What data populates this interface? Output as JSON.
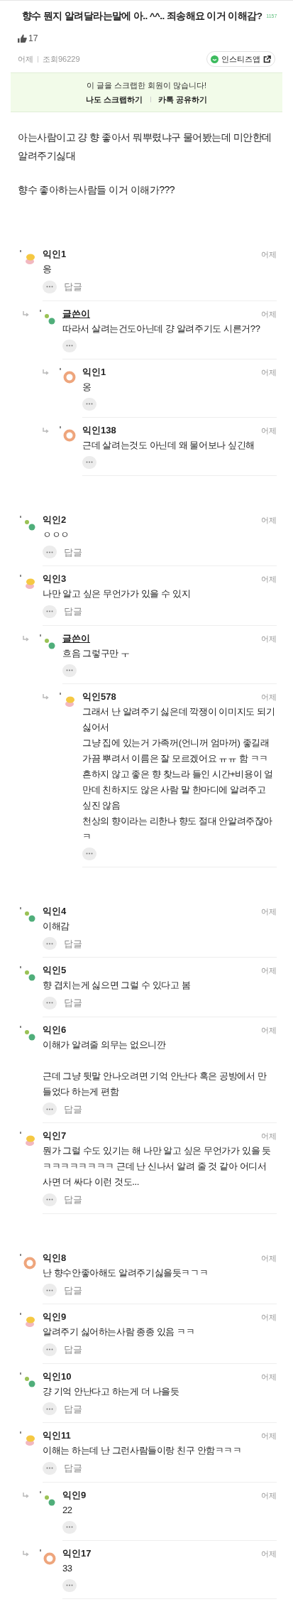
{
  "post": {
    "title": "향수 뭔지 알려달라는말에 아.. ^^.. 죄송해요 이거 이해감?",
    "count": "1157",
    "likes": "17",
    "date": "어제",
    "views": "조회96229",
    "app_button": "인스티즈앱"
  },
  "scrap_box": {
    "message": "이 글을 스크랩한 회원이 많습니다!",
    "actions": [
      "나도 스크랩하기",
      "카톡 공유하기"
    ]
  },
  "body": [
    "아는사람이고 걍 향 좋아서 뭐뿌렸냐구 물어봤는데 미안한데 알려주기싫대",
    "향수 좋아하는사람들 이거 이해가???"
  ],
  "comment_groups": [
    {
      "comments": [
        {
          "author": "익인1",
          "is_writer": false,
          "kind": "sun",
          "time": "어제",
          "text": "응",
          "reply_label": "답글",
          "children": [
            {
              "author": "글쓴이",
              "is_writer": true,
              "kind": "dots",
              "time": "어제",
              "text": "따라서 살려는건도아닌데 걍 알려주기도 시른거??",
              "children": [
                {
                  "author": "익인1",
                  "is_writer": false,
                  "kind": "ring",
                  "time": "어제",
                  "text": "옹"
                },
                {
                  "author": "익인138",
                  "is_writer": false,
                  "kind": "ring",
                  "time": "어제",
                  "text": "근데 살려는것도 아닌데 왜 물어보나 싶긴해"
                }
              ]
            }
          ]
        }
      ]
    },
    {
      "comments": [
        {
          "author": "익인2",
          "is_writer": false,
          "kind": "dots",
          "time": "어제",
          "text": "ㅇㅇㅇ",
          "reply_label": "답글"
        },
        {
          "author": "익인3",
          "is_writer": false,
          "kind": "sun",
          "time": "어제",
          "text": "나만 알고 싶은 무언가가 있을 수 있지",
          "reply_label": "답글",
          "children": [
            {
              "author": "글쓴이",
              "is_writer": true,
              "kind": "dots",
              "time": "어제",
              "text": "흐음 그렇구만 ㅜ",
              "children": [
                {
                  "author": "익인578",
                  "is_writer": false,
                  "kind": "sun",
                  "time": "어제",
                  "text": "그래서 난 알려주기 싫은데 깍쟁이 이미지도 되기 싫어서\n그냥 집에 있는거 가족꺼(언니꺼 엄마꺼) 좋길래 가끔 뿌려서 이름은 잘 모르겠어요 ㅠㅠ 함 ㅋㅋ\n흔하지 않고 좋은 향 찾느라 들인 시간+비용이 얼만데 친하지도 않은 사람 말 한마디에 알려주고 싶진 않음\n천상의 향이라는 리한나 향도 절대 안알려주잖아 ㅋ"
                }
              ]
            }
          ]
        }
      ]
    },
    {
      "comments": [
        {
          "author": "익인4",
          "is_writer": false,
          "kind": "dots",
          "time": "어제",
          "text": "이해감",
          "reply_label": "답글"
        },
        {
          "author": "익인5",
          "is_writer": false,
          "kind": "dots",
          "time": "어제",
          "text": "향 겹치는게 싫으면 그럴 수 있다고 봄",
          "reply_label": "답글"
        },
        {
          "author": "익인6",
          "is_writer": false,
          "kind": "dots",
          "time": "어제",
          "text": "이해가 알려줄 의무는 없으니깐\n\n근데 그냥 뒷말 안나오려면 기억 안난다 혹은 공방에서 만들었다 하는게 편함",
          "reply_label": "답글"
        },
        {
          "author": "익인7",
          "is_writer": false,
          "kind": "sun",
          "time": "어제",
          "text": "뭔가 그럴 수도 있기는 해 나만 알고 싶은 무언가가 있을 듯 ㅋㅋㅋㅋㅋㅋㅋㅋ 근데 난 신나서 알려 줄 것 같아 어디서 사면 더 싸다 이런 것도...",
          "reply_label": "답글"
        }
      ]
    },
    {
      "comments": [
        {
          "author": "익인8",
          "is_writer": false,
          "kind": "ring",
          "time": "어제",
          "text": "난 향수안좋아해도 알려주기싫을듯ㅋㄱㅋ",
          "reply_label": "답글"
        },
        {
          "author": "익인9",
          "is_writer": false,
          "kind": "sun",
          "time": "어제",
          "text": "알려주기 싫어하는사람 종종 있음 ㅋㅋ",
          "reply_label": "답글"
        },
        {
          "author": "익인10",
          "is_writer": false,
          "kind": "dots",
          "time": "어제",
          "text": "걍 기억 안난다고 하는게 더 나을듯",
          "reply_label": "답글"
        },
        {
          "author": "익인11",
          "is_writer": false,
          "kind": "sun",
          "time": "어제",
          "text": "이해는 하는데 난 그런사람들이랑 친구 안함ㅋㅋㅋ",
          "reply_label": "답글",
          "children": [
            {
              "author": "익인9",
              "is_writer": false,
              "kind": "dots",
              "time": "어제",
              "text": "22"
            },
            {
              "author": "익인17",
              "is_writer": false,
              "kind": "ring",
              "time": "어제",
              "text": "33"
            }
          ]
        }
      ]
    }
  ]
}
